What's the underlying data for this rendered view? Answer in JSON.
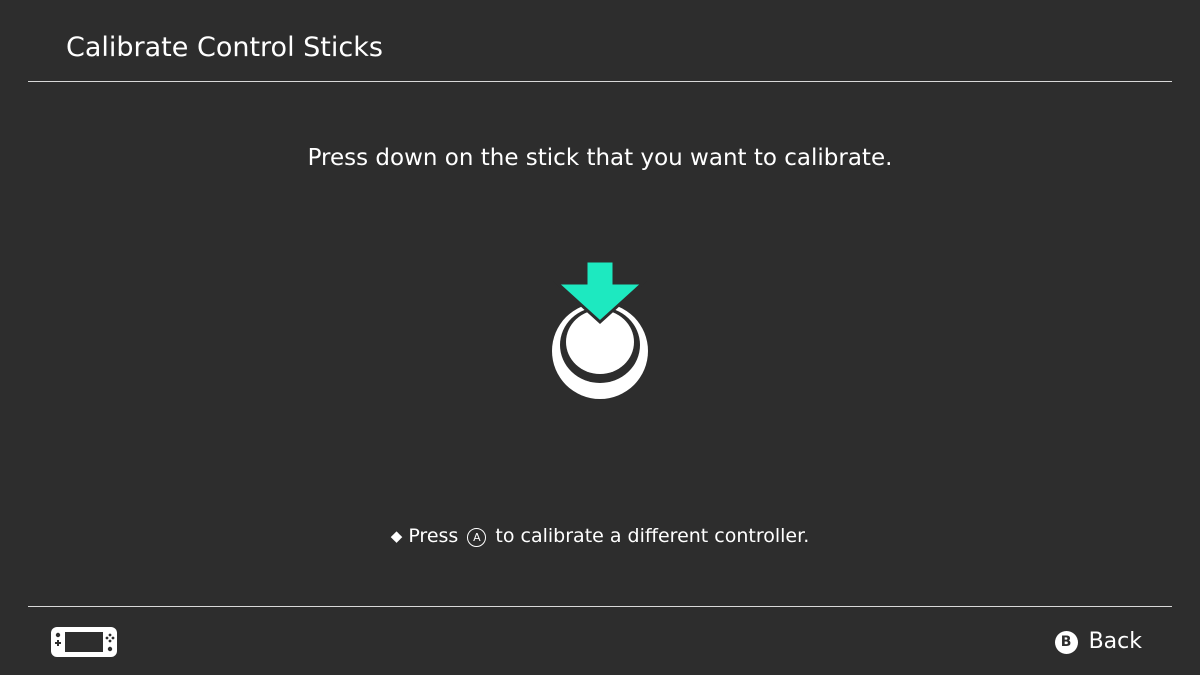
{
  "header": {
    "title": "Calibrate Control Sticks"
  },
  "main": {
    "instruction": "Press down on the stick that you want to calibrate.",
    "graphic": {
      "icon": "stick-press-down-icon",
      "arrow_color": "#1de9c0",
      "stick_color": "#ffffff"
    },
    "hint": {
      "bullet": "◆",
      "prefix": "Press",
      "button_glyph": "A",
      "suffix": "to calibrate a different controller."
    }
  },
  "footer": {
    "controller_icon": "handheld-mode-icon",
    "back": {
      "button_glyph": "B",
      "label": "Back"
    }
  },
  "colors": {
    "background": "#2d2d2d",
    "divider": "#d8d8d8",
    "text": "#ffffff",
    "accent": "#1de9c0"
  }
}
